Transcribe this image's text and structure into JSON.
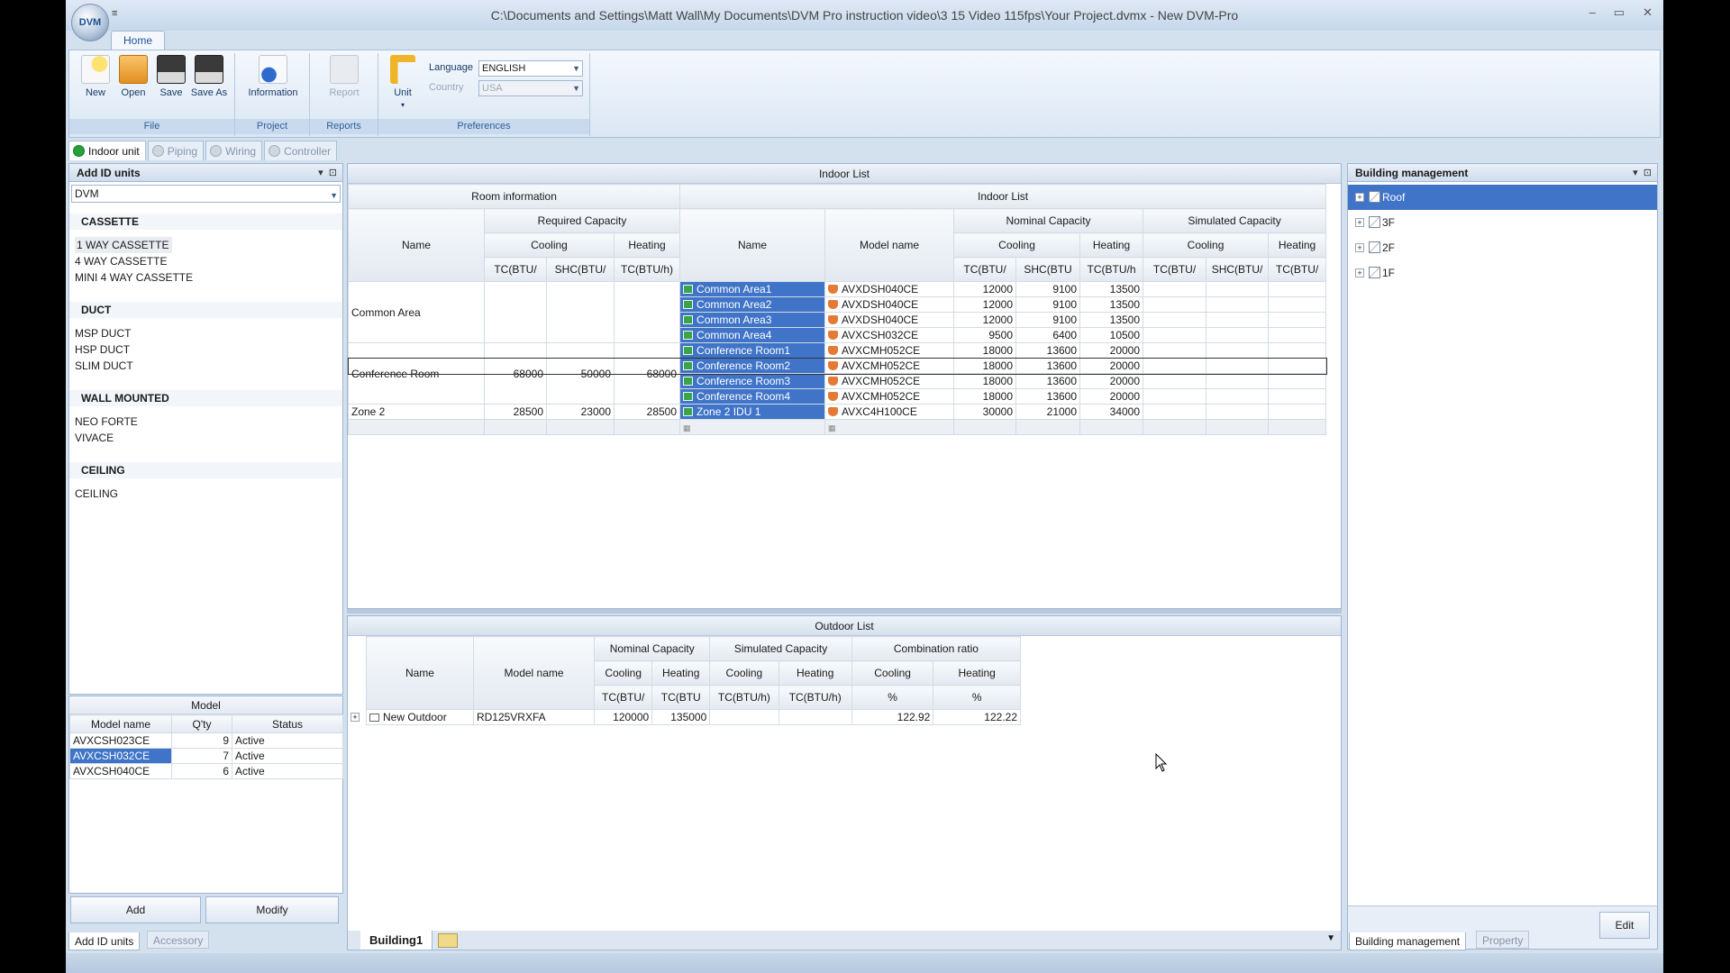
{
  "window": {
    "title": "C:\\Documents and Settings\\Matt Wall\\My Documents\\DVM Pro instruction video\\3 15 Video 115fps\\Your Project.dvmx - New DVM-Pro",
    "logo": "DVM",
    "qat": "≡",
    "min": "–",
    "max": "▭",
    "close": "✕"
  },
  "ribbon": {
    "tab": "Home",
    "file_group": "File",
    "new": "New",
    "open": "Open",
    "save": "Save",
    "save_as": "Save As",
    "project_group": "Project",
    "information": "Information",
    "reports_group": "Reports",
    "report": "Report",
    "preferences_group": "Preferences",
    "unit": "Unit",
    "language_label": "Language",
    "language_value": "ENGLISH",
    "country_label": "Country",
    "country_value": "USA"
  },
  "doc_tabs": [
    "Indoor unit",
    "Piping",
    "Wiring",
    "Controller"
  ],
  "left_panel": {
    "title": "Add ID units",
    "combo": "DVM",
    "categories": [
      {
        "title": "CASSETTE",
        "items": [
          "1 WAY CASSETTE",
          "4 WAY CASSETTE",
          "MINI 4 WAY CASSETTE"
        ]
      },
      {
        "title": "DUCT",
        "items": [
          "MSP DUCT",
          "HSP DUCT",
          "SLIM DUCT"
        ]
      },
      {
        "title": "WALL MOUNTED",
        "items": [
          "NEO FORTE",
          "VIVACE"
        ]
      },
      {
        "title": "CEILING",
        "items": [
          "CEILING"
        ]
      }
    ],
    "model_title": "Model",
    "model_headers": [
      "Model name",
      "Q'ty",
      "Status"
    ],
    "models": [
      {
        "name": "AVXCSH023CE",
        "qty": "9",
        "status": "Active"
      },
      {
        "name": "AVXCSH032CE",
        "qty": "7",
        "status": "Active"
      },
      {
        "name": "AVXCSH040CE",
        "qty": "6",
        "status": "Active"
      }
    ],
    "add_button": "Add",
    "modify_button": "Modify",
    "tab_add": "Add ID units",
    "tab_accessory": "Accessory"
  },
  "indoor_list": {
    "title": "Indoor List",
    "room_information": "Room information",
    "indoor_list_sub": "Indoor List",
    "name_col": "Name",
    "required_capacity": "Required Capacity",
    "cooling": "Cooling",
    "heating": "Heating",
    "tc_btu_trunc": "TC(BTU/",
    "shc_btu_trunc": "SHC(BTU/",
    "tc_btuh": "TC(BTU/h)",
    "model_name_col": "Model name",
    "nominal_capacity": "Nominal Capacity",
    "simulated_capacity": "Simulated Capacity",
    "shc_btu_short": "SHC(BTU",
    "tc_btuh_trunc": "TC(BTU/h",
    "rooms": [
      {
        "name": "Common Area",
        "tc": "",
        "shc": "",
        "heat": ""
      },
      {
        "name": "Conference Room",
        "tc": "68000",
        "shc": "50000",
        "heat": "68000"
      },
      {
        "name": "Zone 2",
        "tc": "28500",
        "shc": "23000",
        "heat": "28500"
      }
    ],
    "units": [
      {
        "name": "Common Area1",
        "model": "AVXDSH040CE",
        "tc": "12000",
        "shc": "9100",
        "heat": "13500"
      },
      {
        "name": "Common Area2",
        "model": "AVXDSH040CE",
        "tc": "12000",
        "shc": "9100",
        "heat": "13500"
      },
      {
        "name": "Common Area3",
        "model": "AVXDSH040CE",
        "tc": "12000",
        "shc": "9100",
        "heat": "13500"
      },
      {
        "name": "Common Area4",
        "model": "AVXCSH032CE",
        "tc": "9500",
        "shc": "6400",
        "heat": "10500"
      },
      {
        "name": "Conference Room1",
        "model": "AVXCMH052CE",
        "tc": "18000",
        "shc": "13600",
        "heat": "20000"
      },
      {
        "name": "Conference Room2",
        "model": "AVXCMH052CE",
        "tc": "18000",
        "shc": "13600",
        "heat": "20000"
      },
      {
        "name": "Conference Room3",
        "model": "AVXCMH052CE",
        "tc": "18000",
        "shc": "13600",
        "heat": "20000"
      },
      {
        "name": "Conference Room4",
        "model": "AVXCMH052CE",
        "tc": "18000",
        "shc": "13600",
        "heat": "20000"
      },
      {
        "name": "Zone 2 IDU 1",
        "model": "AVXC4H100CE",
        "tc": "30000",
        "shc": "21000",
        "heat": "34000"
      }
    ]
  },
  "outdoor_list": {
    "title": "Outdoor List",
    "name_col": "Name",
    "model_col": "Model name",
    "nominal_capacity": "Nominal Capacity",
    "simulated_capacity": "Simulated Capacity",
    "combination_ratio": "Combination ratio",
    "cooling": "Cooling",
    "heating": "Heating",
    "tc_btu_trunc": "TC(BTU/",
    "tc_btu_short": "TC(BTU",
    "tc_btuh": "TC(BTU/h)",
    "percent": "%",
    "row": {
      "name": "New Outdoor",
      "model": "RD125VRXFA",
      "nom_cool": "120000",
      "nom_heat": "135000",
      "sim_cool": "",
      "sim_heat": "",
      "ratio_cool": "122.92",
      "ratio_heat": "122.22"
    }
  },
  "center_tabs": {
    "building": "Building1"
  },
  "building_panel": {
    "title": "Building management",
    "floors": [
      "Roof",
      "3F",
      "2F",
      "1F"
    ],
    "edit_button": "Edit",
    "tab_building": "Building management",
    "tab_property": "Property"
  }
}
